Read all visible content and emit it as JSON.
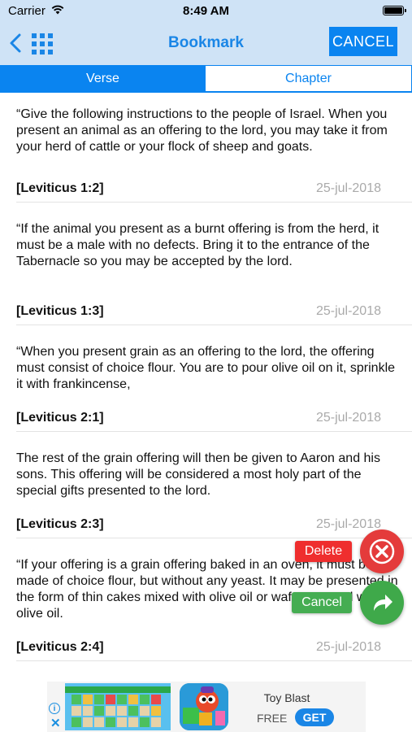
{
  "status_bar": {
    "carrier": "Carrier",
    "time": "8:49 AM"
  },
  "nav": {
    "title": "Bookmark",
    "cancel_label": "CANCEL"
  },
  "tabs": [
    {
      "label": "Verse",
      "active": true
    },
    {
      "label": "Chapter",
      "active": false
    }
  ],
  "bookmarks": [
    {
      "text": "“Give the following instructions to the people of Israel. When you present an animal as an offering to the lord, you may take it from your herd of cattle or your flock of sheep and goats.",
      "reference": "[Leviticus 1:2]",
      "date": "25-jul-2018"
    },
    {
      "text": "“If the animal you present as a burnt offering is from the herd, it must be a male with no defects. Bring it to the entrance of the Tabernacle so you may be accepted by the lord.",
      "reference": "[Leviticus 1:3]",
      "date": "25-jul-2018"
    },
    {
      "text": "“When you present grain as an offering to the lord, the offering must consist of choice flour. You are to pour olive oil on it, sprinkle it with frankincense,",
      "reference": "[Leviticus 2:1]",
      "date": "25-jul-2018"
    },
    {
      "text": "The rest of the grain offering will then be given to Aaron and his sons. This offering will be considered a most holy part of the special gifts presented to the lord.",
      "reference": "[Leviticus 2:3]",
      "date": "25-jul-2018"
    },
    {
      "text": "“If your offering is a grain offering baked in an oven, it must be made of choice flour, but without any yeast. It may be presented in the form of thin cakes mixed with olive oil or wafers spread with olive oil.",
      "reference": "[Leviticus 2:4]",
      "date": "25-jul-2018"
    }
  ],
  "actions": {
    "delete_label": "Delete",
    "cancel_label": "Cancel"
  },
  "ad": {
    "app_name": "Toy Blast",
    "price": "FREE",
    "get_label": "GET",
    "info_glyph": "i",
    "close_glyph": "✕"
  },
  "colors": {
    "accent": "#0a84f0",
    "nav_bg": "#cfe3f6",
    "delete": "#e43b3b",
    "share": "#3fa94a"
  }
}
